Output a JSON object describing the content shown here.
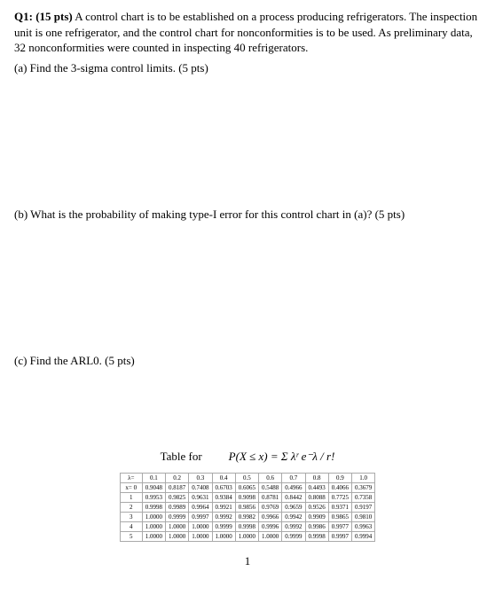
{
  "question": {
    "label": "Q1: (15 pts)",
    "intro": "A control chart is to be established on a process producing refrigerators. The inspection unit is one refrigerator, and the control chart for nonconformities is to be used. As preliminary data, 32 nonconformities were counted in inspecting 40 refrigerators.",
    "part_a": "(a) Find the 3-sigma control limits. (5 pts)",
    "part_b": "(b) What is the probability of making type-I error for this control chart in (a)? (5 pts)",
    "part_c": "(c) Find the ARL0. (5 pts)"
  },
  "table_caption": "Table for",
  "formula": "P(X ≤ x) = Σ λʳ e⁻λ / r!",
  "lambda_header": "λ=",
  "x_header": "x=",
  "cols": [
    "0.1",
    "0.2",
    "0.3",
    "0.4",
    "0.5",
    "0.6",
    "0.7",
    "0.8",
    "0.9",
    "1.0"
  ],
  "rows": [
    {
      "x": "0",
      "v": [
        "0.9048",
        "0.8187",
        "0.7408",
        "0.6703",
        "0.6065",
        "0.5488",
        "0.4966",
        "0.4493",
        "0.4066",
        "0.3679"
      ]
    },
    {
      "x": "1",
      "v": [
        "0.9953",
        "0.9825",
        "0.9631",
        "0.9384",
        "0.9098",
        "0.8781",
        "0.8442",
        "0.8088",
        "0.7725",
        "0.7358"
      ]
    },
    {
      "x": "2",
      "v": [
        "0.9998",
        "0.9989",
        "0.9964",
        "0.9921",
        "0.9856",
        "0.9769",
        "0.9659",
        "0.9526",
        "0.9371",
        "0.9197"
      ]
    },
    {
      "x": "3",
      "v": [
        "1.0000",
        "0.9999",
        "0.9997",
        "0.9992",
        "0.9982",
        "0.9966",
        "0.9942",
        "0.9909",
        "0.9865",
        "0.9810"
      ]
    },
    {
      "x": "4",
      "v": [
        "1.0000",
        "1.0000",
        "1.0000",
        "0.9999",
        "0.9998",
        "0.9996",
        "0.9992",
        "0.9986",
        "0.9977",
        "0.9963"
      ]
    },
    {
      "x": "5",
      "v": [
        "1.0000",
        "1.0000",
        "1.0000",
        "1.0000",
        "1.0000",
        "1.0000",
        "0.9999",
        "0.9998",
        "0.9997",
        "0.9994"
      ]
    }
  ],
  "footer_page": "1"
}
